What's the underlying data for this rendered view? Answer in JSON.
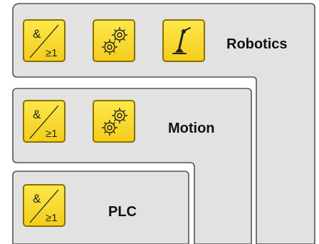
{
  "colors": {
    "panel_fill": "#e2e2e2",
    "panel_border": "#555555",
    "tile_fill": "#f9dc2f",
    "tile_border": "#8a7000"
  },
  "groups": {
    "robotics": {
      "label": "Robotics",
      "tiles": [
        {
          "icon": "logic-and-or-icon",
          "text_top": "&",
          "text_bottom": "≥1"
        },
        {
          "icon": "gears-icon"
        },
        {
          "icon": "robot-arm-icon"
        }
      ]
    },
    "motion": {
      "label": "Motion",
      "tiles": [
        {
          "icon": "logic-and-or-icon",
          "text_top": "&",
          "text_bottom": "≥1"
        },
        {
          "icon": "gears-icon"
        }
      ]
    },
    "plc": {
      "label": "PLC",
      "tiles": [
        {
          "icon": "logic-and-or-icon",
          "text_top": "&",
          "text_bottom": "≥1"
        }
      ]
    }
  }
}
